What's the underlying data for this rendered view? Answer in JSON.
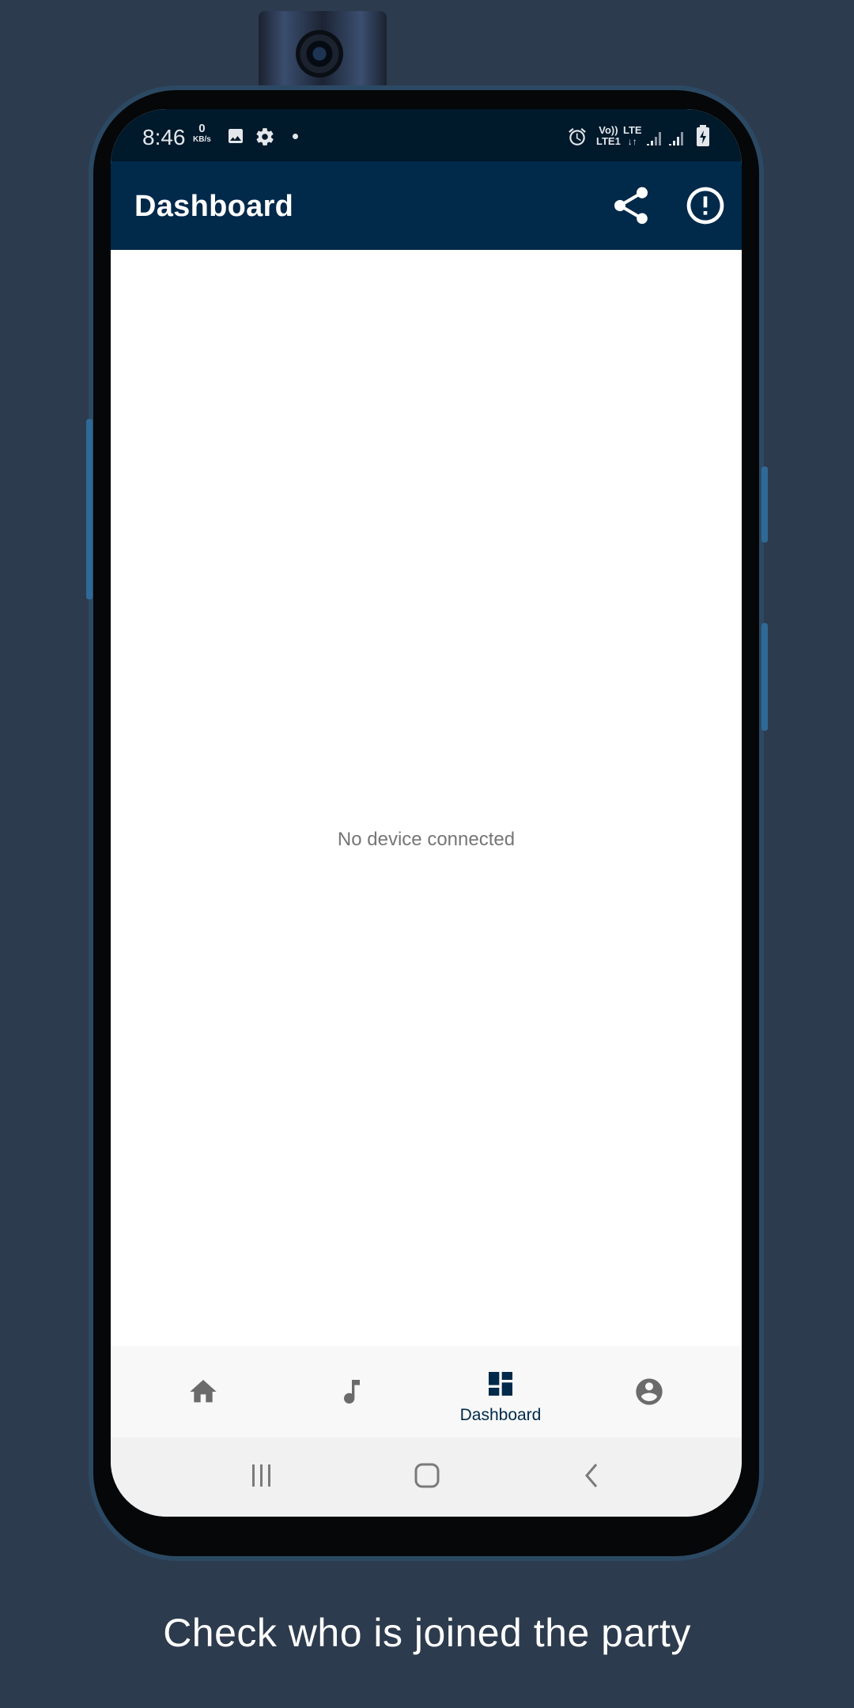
{
  "status_bar": {
    "time": "8:46",
    "net_speed_value": "0",
    "net_speed_unit": "KB/s",
    "volte": "Vo))",
    "lte1": "LTE1",
    "lte": "LTE"
  },
  "app_bar": {
    "title": "Dashboard",
    "actions": [
      "share-icon",
      "info-icon"
    ]
  },
  "content": {
    "empty_message": "No device connected"
  },
  "bottom_nav": {
    "items": [
      {
        "icon": "home-icon",
        "label": ""
      },
      {
        "icon": "music-note-icon",
        "label": ""
      },
      {
        "icon": "dashboard-icon",
        "label": "Dashboard"
      },
      {
        "icon": "account-icon",
        "label": ""
      }
    ],
    "active_index": 2
  },
  "system_nav": [
    "recent-apps-icon",
    "home-button-icon",
    "back-icon"
  ],
  "caption": "Check who is joined the party",
  "colors": {
    "background": "#2d3b4e",
    "app_bar": "#00294a",
    "status_bar": "#00192b",
    "active_nav": "#00294a",
    "inactive_nav": "#6b6b6b"
  }
}
